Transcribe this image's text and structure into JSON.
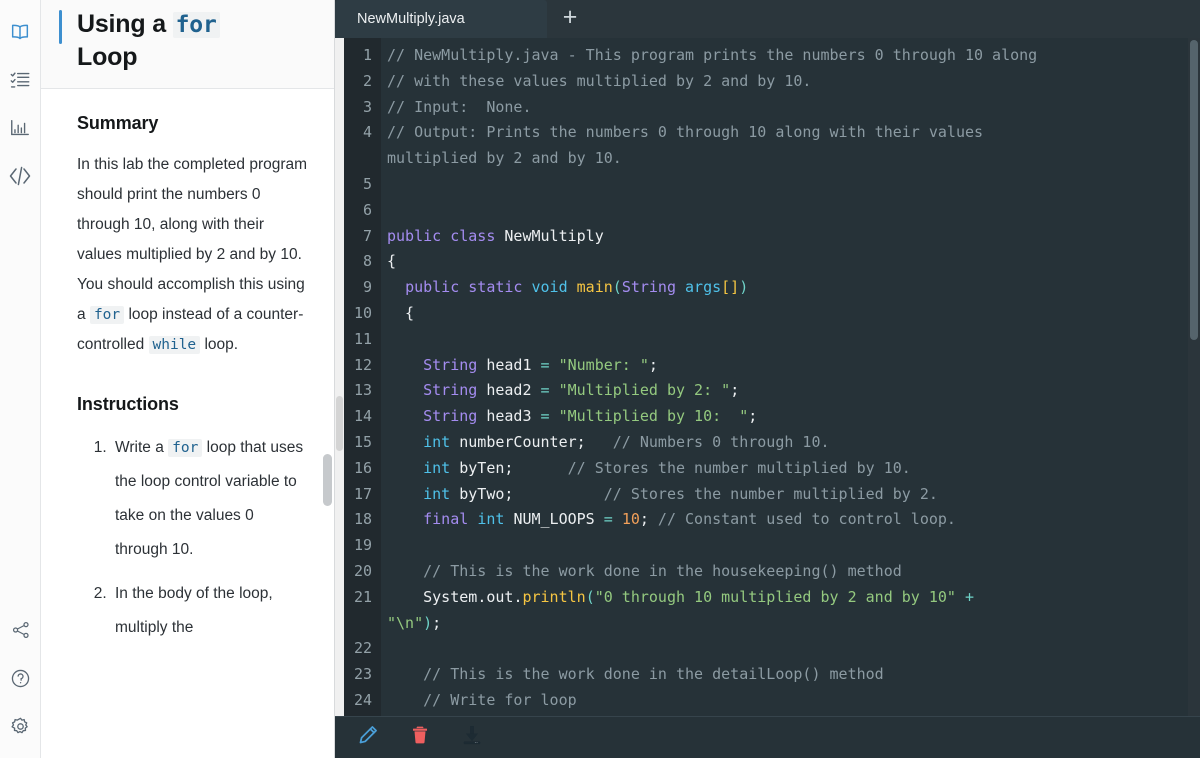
{
  "rail": {
    "items_top": [
      {
        "name": "book-icon",
        "label": "Lab instructions",
        "active": true
      },
      {
        "name": "checklist-icon",
        "label": "Checklist",
        "active": false
      },
      {
        "name": "chart-icon",
        "label": "Grade report",
        "active": false
      },
      {
        "name": "code-icon",
        "label": "Code",
        "active": false
      }
    ],
    "items_bottom": [
      {
        "name": "share-icon",
        "label": "Share"
      },
      {
        "name": "help-icon",
        "label": "Help"
      },
      {
        "name": "gear-icon",
        "label": "Settings"
      }
    ]
  },
  "lab": {
    "title_pre": "Using a ",
    "title_code": "for",
    "title_post": "Loop",
    "summary_heading": "Summary",
    "summary_parts": [
      {
        "type": "text",
        "text": "In this lab the completed program should print the numbers 0 through 10, along with their values multiplied by 2 and by 10. You should accomplish this using a "
      },
      {
        "type": "code",
        "text": "for"
      },
      {
        "type": "text",
        "text": " loop instead of a counter-controlled "
      },
      {
        "type": "code",
        "text": "while"
      },
      {
        "type": "text",
        "text": " loop."
      }
    ],
    "instructions_heading": "Instructions",
    "instructions": [
      {
        "parts": [
          {
            "type": "text",
            "text": "Write a "
          },
          {
            "type": "code",
            "text": "for"
          },
          {
            "type": "text",
            "text": " loop that uses the loop control variable to take on the values 0 through 10."
          }
        ]
      },
      {
        "parts": [
          {
            "type": "text",
            "text": "In the body of the loop, multiply the"
          }
        ]
      }
    ]
  },
  "editor": {
    "tab_label": "NewMultiply.java",
    "new_tab_label": "+",
    "toolbar": [
      {
        "name": "edit-pencil-icon",
        "label": "Edit"
      },
      {
        "name": "delete-trash-icon",
        "label": "Delete"
      },
      {
        "name": "download-icon",
        "label": "Download"
      }
    ],
    "lines": [
      {
        "n": "1",
        "tokens": [
          {
            "c": "t-com",
            "t": "// NewMultiply.java - This program prints the numbers 0 through 10 along"
          }
        ]
      },
      {
        "n": "2",
        "tokens": [
          {
            "c": "t-com",
            "t": "// with these values multiplied by 2 and by 10."
          }
        ]
      },
      {
        "n": "3",
        "tokens": [
          {
            "c": "t-com",
            "t": "// Input:  None."
          }
        ]
      },
      {
        "n": "4",
        "tokens": [
          {
            "c": "t-com",
            "t": "// Output: Prints the numbers 0 through 10 along with their values"
          }
        ],
        "cont": [
          {
            "c": "t-com",
            "t": "multiplied by 2 and by 10."
          }
        ]
      },
      {
        "n": "5",
        "tokens": []
      },
      {
        "n": "6",
        "tokens": []
      },
      {
        "n": "7",
        "tokens": [
          {
            "c": "t-key",
            "t": "public"
          },
          {
            "c": "t-pln",
            "t": " "
          },
          {
            "c": "t-key",
            "t": "class"
          },
          {
            "c": "t-pln",
            "t": " "
          },
          {
            "c": "t-pln",
            "t": "NewMultiply"
          }
        ]
      },
      {
        "n": "8",
        "tokens": [
          {
            "c": "t-pln",
            "t": "{"
          }
        ]
      },
      {
        "n": "9",
        "tokens": [
          {
            "c": "t-pln",
            "t": "  "
          },
          {
            "c": "t-key",
            "t": "public"
          },
          {
            "c": "t-pln",
            "t": " "
          },
          {
            "c": "t-key",
            "t": "static"
          },
          {
            "c": "t-pln",
            "t": " "
          },
          {
            "c": "t-type",
            "t": "void"
          },
          {
            "c": "t-pln",
            "t": " "
          },
          {
            "c": "t-fn",
            "t": "main"
          },
          {
            "c": "t-op",
            "t": "("
          },
          {
            "c": "t-pur",
            "t": "String"
          },
          {
            "c": "t-pln",
            "t": " "
          },
          {
            "c": "t-var",
            "t": "args"
          },
          {
            "c": "t-fn",
            "t": "[]"
          },
          {
            "c": "t-op",
            "t": ")"
          }
        ]
      },
      {
        "n": "10",
        "tokens": [
          {
            "c": "t-pln",
            "t": "  {"
          }
        ]
      },
      {
        "n": "11",
        "tokens": []
      },
      {
        "n": "12",
        "tokens": [
          {
            "c": "t-pln",
            "t": "    "
          },
          {
            "c": "t-pur",
            "t": "String"
          },
          {
            "c": "t-pln",
            "t": " "
          },
          {
            "c": "t-pln",
            "t": "head1"
          },
          {
            "c": "t-pln",
            "t": " "
          },
          {
            "c": "t-op",
            "t": "="
          },
          {
            "c": "t-pln",
            "t": " "
          },
          {
            "c": "t-str",
            "t": "\"Number: \""
          },
          {
            "c": "t-pln",
            "t": ";"
          }
        ]
      },
      {
        "n": "13",
        "tokens": [
          {
            "c": "t-pln",
            "t": "    "
          },
          {
            "c": "t-pur",
            "t": "String"
          },
          {
            "c": "t-pln",
            "t": " "
          },
          {
            "c": "t-pln",
            "t": "head2"
          },
          {
            "c": "t-pln",
            "t": " "
          },
          {
            "c": "t-op",
            "t": "="
          },
          {
            "c": "t-pln",
            "t": " "
          },
          {
            "c": "t-str",
            "t": "\"Multiplied by 2: \""
          },
          {
            "c": "t-pln",
            "t": ";"
          }
        ]
      },
      {
        "n": "14",
        "tokens": [
          {
            "c": "t-pln",
            "t": "    "
          },
          {
            "c": "t-pur",
            "t": "String"
          },
          {
            "c": "t-pln",
            "t": " "
          },
          {
            "c": "t-pln",
            "t": "head3"
          },
          {
            "c": "t-pln",
            "t": " "
          },
          {
            "c": "t-op",
            "t": "="
          },
          {
            "c": "t-pln",
            "t": " "
          },
          {
            "c": "t-str",
            "t": "\"Multiplied by 10:  \""
          },
          {
            "c": "t-pln",
            "t": ";"
          }
        ]
      },
      {
        "n": "15",
        "tokens": [
          {
            "c": "t-pln",
            "t": "    "
          },
          {
            "c": "t-type",
            "t": "int"
          },
          {
            "c": "t-pln",
            "t": " "
          },
          {
            "c": "t-pln",
            "t": "numberCounter;"
          },
          {
            "c": "t-com",
            "t": "   // Numbers 0 through 10."
          }
        ]
      },
      {
        "n": "16",
        "tokens": [
          {
            "c": "t-pln",
            "t": "    "
          },
          {
            "c": "t-type",
            "t": "int"
          },
          {
            "c": "t-pln",
            "t": " "
          },
          {
            "c": "t-pln",
            "t": "byTen;"
          },
          {
            "c": "t-com",
            "t": "      // Stores the number multiplied by 10."
          }
        ]
      },
      {
        "n": "17",
        "tokens": [
          {
            "c": "t-pln",
            "t": "    "
          },
          {
            "c": "t-type",
            "t": "int"
          },
          {
            "c": "t-pln",
            "t": " "
          },
          {
            "c": "t-pln",
            "t": "byTwo;"
          },
          {
            "c": "t-com",
            "t": "          // Stores the number multiplied by 2."
          }
        ]
      },
      {
        "n": "18",
        "tokens": [
          {
            "c": "t-pln",
            "t": "    "
          },
          {
            "c": "t-key",
            "t": "final"
          },
          {
            "c": "t-pln",
            "t": " "
          },
          {
            "c": "t-type",
            "t": "int"
          },
          {
            "c": "t-pln",
            "t": " "
          },
          {
            "c": "t-pln",
            "t": "NUM_LOOPS"
          },
          {
            "c": "t-pln",
            "t": " "
          },
          {
            "c": "t-op",
            "t": "="
          },
          {
            "c": "t-pln",
            "t": " "
          },
          {
            "c": "t-num",
            "t": "10"
          },
          {
            "c": "t-pln",
            "t": ";"
          },
          {
            "c": "t-com",
            "t": " // Constant used to control loop."
          }
        ]
      },
      {
        "n": "19",
        "tokens": []
      },
      {
        "n": "20",
        "tokens": [
          {
            "c": "t-pln",
            "t": "    "
          },
          {
            "c": "t-com",
            "t": "// This is the work done in the housekeeping() method"
          }
        ]
      },
      {
        "n": "21",
        "tokens": [
          {
            "c": "t-pln",
            "t": "    "
          },
          {
            "c": "t-pln",
            "t": "System"
          },
          {
            "c": "t-pln",
            "t": "."
          },
          {
            "c": "t-pln",
            "t": "out"
          },
          {
            "c": "t-pln",
            "t": "."
          },
          {
            "c": "t-fn",
            "t": "println"
          },
          {
            "c": "t-op",
            "t": "("
          },
          {
            "c": "t-str",
            "t": "\"0 through 10 multiplied by 2 and by 10\""
          },
          {
            "c": "t-pln",
            "t": " "
          },
          {
            "c": "t-op",
            "t": "+"
          }
        ],
        "cont": [
          {
            "c": "t-str",
            "t": "\"\\n\""
          },
          {
            "c": "t-op",
            "t": ")"
          },
          {
            "c": "t-pln",
            "t": ";"
          }
        ]
      },
      {
        "n": "22",
        "tokens": []
      },
      {
        "n": "23",
        "tokens": [
          {
            "c": "t-pln",
            "t": "    "
          },
          {
            "c": "t-com",
            "t": "// This is the work done in the detailLoop() method"
          }
        ]
      },
      {
        "n": "24",
        "tokens": [
          {
            "c": "t-pln",
            "t": "    "
          },
          {
            "c": "t-com",
            "t": "// Write for loop"
          }
        ]
      }
    ]
  },
  "colors": {
    "accent": "#3d8fcf",
    "editor_bg": "#263238",
    "gutter_bg": "#21292e",
    "tabbar_bg": "#2b363c",
    "tab_active_bg": "#2e3c44",
    "pencil": "#4a9fd8",
    "trash": "#ef5f5f",
    "download": "#1d2b33"
  }
}
